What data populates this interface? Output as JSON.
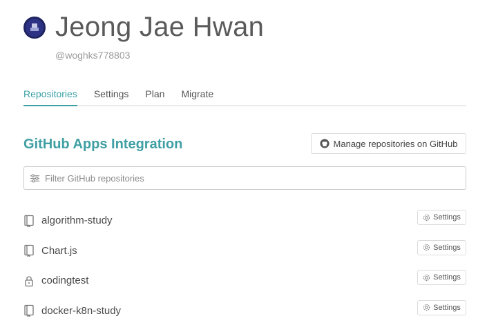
{
  "profile": {
    "name": "Jeong Jae Hwan",
    "handle": "@woghks778803"
  },
  "tabs": [
    {
      "label": "Repositories",
      "active": true
    },
    {
      "label": "Settings",
      "active": false
    },
    {
      "label": "Plan",
      "active": false
    },
    {
      "label": "Migrate",
      "active": false
    }
  ],
  "section": {
    "title": "GitHub Apps Integration",
    "manage_label": "Manage repositories on GitHub"
  },
  "filter": {
    "placeholder": "Filter GitHub repositories",
    "value": ""
  },
  "repositories": [
    {
      "name": "algorithm-study",
      "icon": "repo-icon",
      "settings_label": "Settings"
    },
    {
      "name": "Chart.js",
      "icon": "repo-icon",
      "settings_label": "Settings"
    },
    {
      "name": "codingtest",
      "icon": "lock-icon",
      "settings_label": "Settings"
    },
    {
      "name": "docker-k8n-study",
      "icon": "repo-icon",
      "settings_label": "Settings"
    }
  ],
  "colors": {
    "accent": "#3f9fa3",
    "border": "#dcdcdc",
    "text": "#4a4a4a"
  }
}
